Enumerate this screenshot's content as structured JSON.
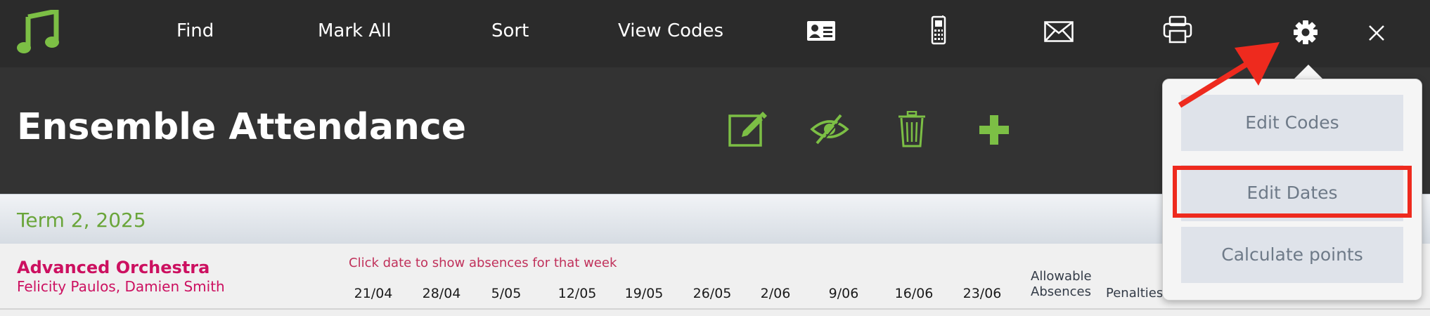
{
  "toolbar": {
    "logo_icon": "music-note-icon",
    "links": [
      {
        "label": "Find"
      },
      {
        "label": "Mark All"
      },
      {
        "label": "Sort"
      },
      {
        "label": "View Codes"
      }
    ],
    "icons": [
      "id-card-icon",
      "mobile-phone-icon",
      "envelope-icon",
      "printer-icon",
      "gear-icon",
      "close-icon"
    ]
  },
  "header": {
    "title": "Ensemble Attendance",
    "icons": [
      "edit-icon",
      "hide-icon",
      "trash-icon",
      "add-icon"
    ]
  },
  "term": {
    "label": "Term 2, 2025"
  },
  "group": {
    "name": "Advanced Orchestra",
    "teachers": "Felicity Paulos, Damien Smith",
    "hint": "Click date to show absences for that week",
    "dates": [
      "21/04",
      "28/04",
      "5/05",
      "12/05",
      "19/05",
      "26/05",
      "2/06",
      "9/06",
      "16/06",
      "23/06"
    ],
    "allowable_line1": "Allowable",
    "allowable_line2": "Absences",
    "penalties": "Penalties"
  },
  "settings_menu": {
    "items": [
      {
        "label": "Edit Codes"
      },
      {
        "label": "Edit Dates"
      },
      {
        "label": "Calculate points"
      }
    ],
    "highlighted_item": "Edit Dates"
  },
  "colors": {
    "accent_green": "#7cbf45",
    "title_magenta": "#cc1060",
    "annotation_red": "#ee2a1e"
  }
}
